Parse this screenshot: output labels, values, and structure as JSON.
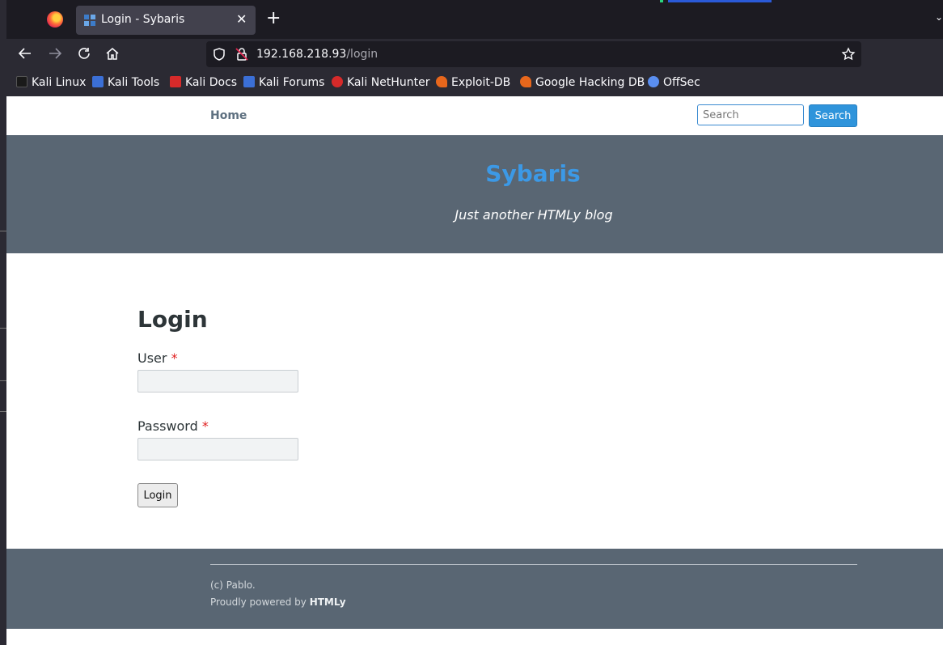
{
  "browser": {
    "tab": {
      "title": "Login - Sybaris"
    },
    "url": {
      "host": "192.168.218.93",
      "path": "/login"
    },
    "bookmarks": [
      {
        "label": "Kali Linux",
        "color": "#1a1a1a"
      },
      {
        "label": "Kali Tools",
        "color": "#3b6fd6"
      },
      {
        "label": "Kali Docs",
        "color": "#d62a2a"
      },
      {
        "label": "Kali Forums",
        "color": "#3b6fd6"
      },
      {
        "label": "Kali NetHunter",
        "color": "#d62a2a"
      },
      {
        "label": "Exploit-DB",
        "color": "#e8671c"
      },
      {
        "label": "Google Hacking DB",
        "color": "#e8671c"
      },
      {
        "label": "OffSec",
        "color": "#5a8ef0"
      }
    ]
  },
  "site": {
    "nav": {
      "home": "Home"
    },
    "search": {
      "placeholder": "Search",
      "button": "Search"
    },
    "title": "Sybaris",
    "tagline": "Just another HTMLy blog"
  },
  "login": {
    "heading": "Login",
    "user_label": "User",
    "password_label": "Password",
    "required_mark": "*",
    "submit": "Login"
  },
  "footer": {
    "copyright": "(c) Pablo.",
    "powered_prefix": "Proudly powered by",
    "powered_link": "HTMLy"
  }
}
